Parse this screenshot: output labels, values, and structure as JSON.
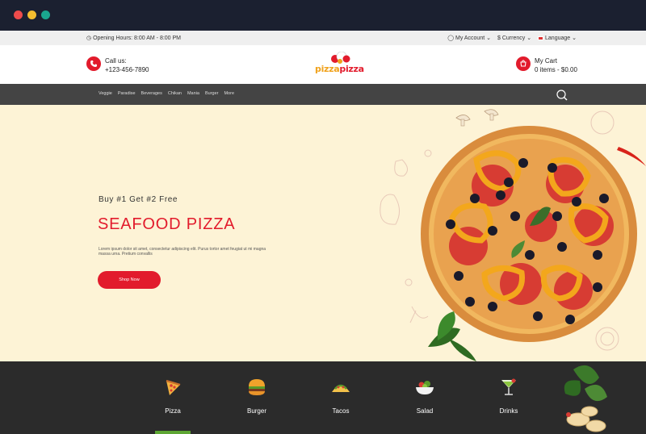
{
  "topbar": {
    "hours": "Opening Hours: 8:00 AM - 8:00 PM",
    "account": "My Account",
    "currency": "$ Currency",
    "language": "Language"
  },
  "header": {
    "call_label": "Call us:",
    "call_number": "+123-456-7890",
    "logo_first": "pizza",
    "logo_second": "pizza",
    "cart_label": "My Cart",
    "cart_summary": "0 items - $0.00"
  },
  "nav": {
    "items": [
      "Veggie",
      "Paradise",
      "Beverages",
      "Chikan",
      "Mania",
      "Burger",
      "More"
    ]
  },
  "hero": {
    "promo": "Buy #1 Get #2 Free",
    "title": "SEAFOOD PIZZA",
    "description": "Lorem ipsum dolor sit amet, consectetur adipiscing elit. Purus tortor amet feugiat ut mi magna massa urna. Pretium convallis",
    "button": "Shop Now"
  },
  "categories": {
    "items": [
      {
        "label": "Pizza",
        "icon": "pizza-slice-icon"
      },
      {
        "label": "Burger",
        "icon": "burger-icon"
      },
      {
        "label": "Tacos",
        "icon": "tacos-icon"
      },
      {
        "label": "Salad",
        "icon": "salad-icon"
      },
      {
        "label": "Drinks",
        "icon": "drinks-icon"
      }
    ],
    "active_index": 0
  },
  "colors": {
    "brand_red": "#e21b2c",
    "brand_orange": "#f0a21c",
    "hero_bg": "#fdf3d6",
    "nav_bg": "#444444",
    "categories_bg": "#2b2b2b",
    "active_underline": "#5da633"
  }
}
